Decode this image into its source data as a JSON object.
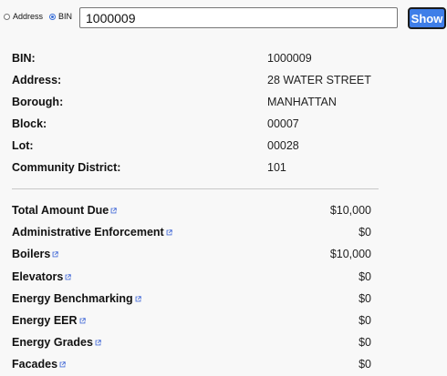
{
  "search": {
    "radio_address_label": "Address",
    "radio_bin_label": "BIN",
    "selected": "BIN",
    "input_value": "1000009",
    "show_label": "Show"
  },
  "property": [
    {
      "label": "BIN:",
      "value": "1000009"
    },
    {
      "label": "Address:",
      "value": "28 WATER STREET"
    },
    {
      "label": "Borough:",
      "value": "MANHATTAN"
    },
    {
      "label": "Block:",
      "value": "00007"
    },
    {
      "label": "Lot:",
      "value": "00028"
    },
    {
      "label": "Community District:",
      "value": "101"
    }
  ],
  "amounts": [
    {
      "label": "Total Amount Due",
      "value": "$10,000",
      "icon": "external-link-icon"
    },
    {
      "label": "Administrative Enforcement",
      "value": "$0",
      "icon": "external-link-icon"
    },
    {
      "label": "Boilers",
      "value": "$10,000",
      "icon": "external-link-icon"
    },
    {
      "label": "Elevators",
      "value": "$0",
      "icon": "external-link-icon"
    },
    {
      "label": "Energy Benchmarking",
      "value": "$0",
      "icon": "external-link-icon"
    },
    {
      "label": "Energy EER",
      "value": "$0",
      "icon": "external-link-icon"
    },
    {
      "label": "Energy Grades",
      "value": "$0",
      "icon": "external-link-icon"
    },
    {
      "label": "Facades",
      "value": "$0",
      "icon": "external-link-icon"
    }
  ],
  "colors": {
    "accent": "#3f7ee8",
    "link_icon": "#4a6fd8",
    "background": "#f8f8f8"
  }
}
